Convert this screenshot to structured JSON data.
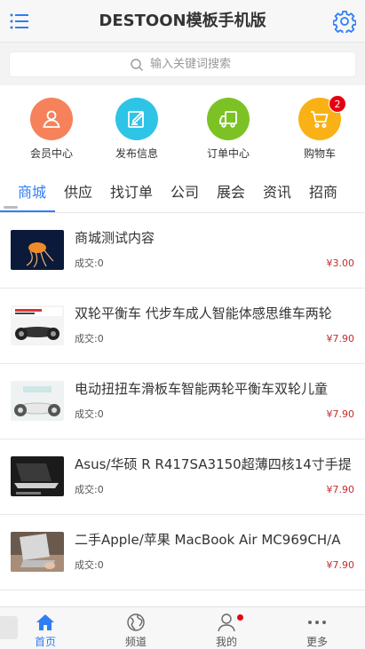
{
  "header": {
    "title": "DESTOON模板手机版"
  },
  "search": {
    "placeholder": "输入关键词搜索"
  },
  "quick": [
    {
      "label": "会员中心",
      "color": "#f5825a",
      "icon": "user-icon"
    },
    {
      "label": "发布信息",
      "color": "#2ec4e6",
      "icon": "edit-icon"
    },
    {
      "label": "订单中心",
      "color": "#7cc225",
      "icon": "truck-icon"
    },
    {
      "label": "购物车",
      "color": "#f9b116",
      "icon": "cart-icon",
      "badge": "2"
    }
  ],
  "tabs": [
    "商城",
    "供应",
    "找订单",
    "公司",
    "展会",
    "资讯",
    "招商"
  ],
  "items": [
    {
      "name": "商城测试内容",
      "deal": "成交:0",
      "price": "¥3.00"
    },
    {
      "name": "双轮平衡车 代步车成人智能体感思维车两轮",
      "deal": "成交:0",
      "price": "¥7.90"
    },
    {
      "name": "电动扭扭车滑板车智能两轮平衡车双轮儿童",
      "deal": "成交:0",
      "price": "¥7.90"
    },
    {
      "name": "Asus/华硕 R R417SA3150超薄四核14寸手提",
      "deal": "成交:0",
      "price": "¥7.90"
    },
    {
      "name": "二手Apple/苹果 MacBook Air MC969CH/A",
      "deal": "成交:0",
      "price": "¥7.90"
    }
  ],
  "nav": [
    {
      "label": "首页",
      "icon": "home-icon",
      "active": true
    },
    {
      "label": "频道",
      "icon": "globe-icon"
    },
    {
      "label": "我的",
      "icon": "profile-icon"
    },
    {
      "label": "更多",
      "icon": "more-icon"
    }
  ],
  "colors": {
    "accent": "#2f7ef4",
    "price": "#c52b2b",
    "badge": "#e60012"
  }
}
